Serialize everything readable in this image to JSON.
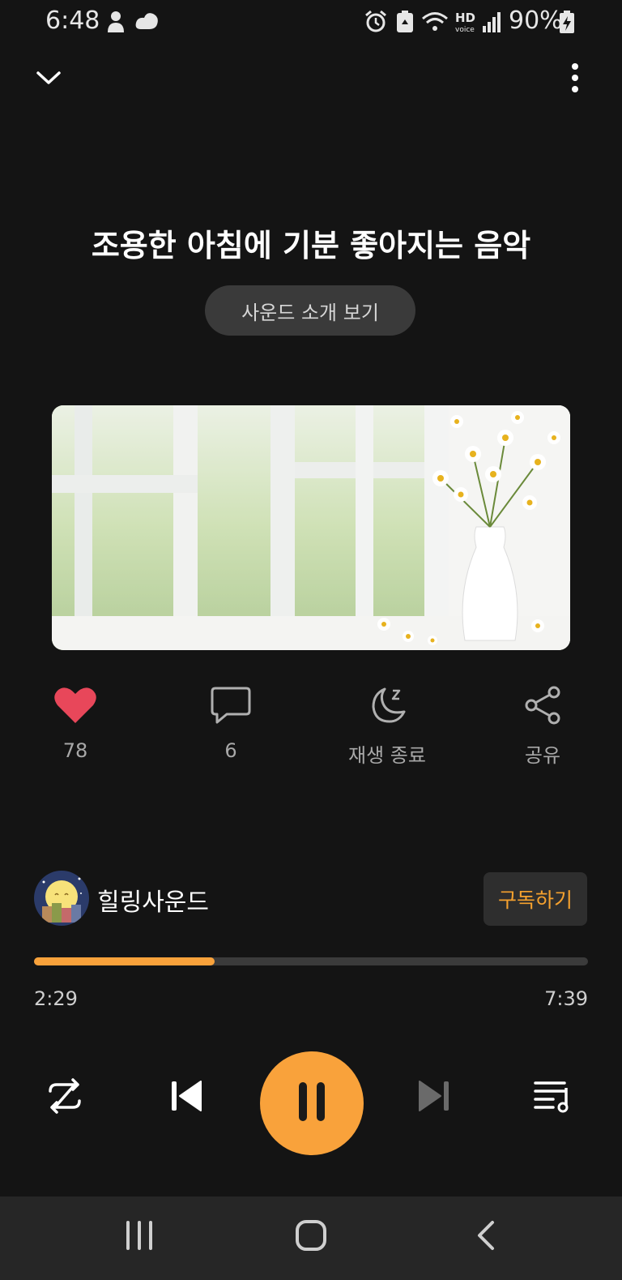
{
  "status_bar": {
    "time": "6:48",
    "battery": "90%",
    "icons": [
      "user-icon",
      "cloud-icon",
      "alarm-icon",
      "recycle-icon",
      "wifi-icon",
      "hd-voice-icon",
      "signal-icon",
      "battery-charging-icon"
    ]
  },
  "header": {
    "collapse_icon": "chevron-down-icon",
    "more_icon": "more-vertical-icon"
  },
  "track": {
    "title": "조용한 아침에 기분 좋아지는 음악",
    "intro_button": "사운드 소개 보기"
  },
  "actions": {
    "like_count": "78",
    "comment_count": "6",
    "sleep_label": "재생 종료",
    "share_label": "공유"
  },
  "channel": {
    "name": "힐링사운드",
    "subscribe_label": "구독하기"
  },
  "playback": {
    "elapsed": "2:29",
    "total": "7:39",
    "progress": 0.326
  },
  "colors": {
    "accent": "#f9a23b",
    "like": "#e8475a",
    "background": "#141414"
  }
}
